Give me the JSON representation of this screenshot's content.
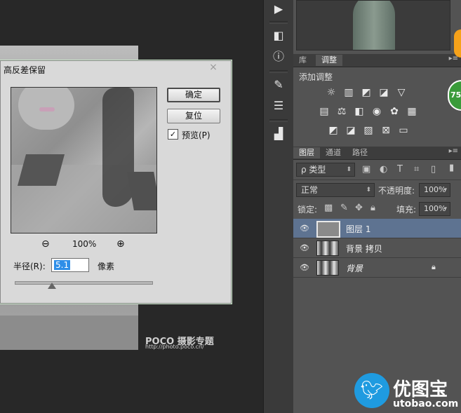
{
  "dialog": {
    "title": "高反差保留",
    "close_glyph": "×",
    "ok_label": "确定",
    "reset_label": "复位",
    "preview_label": "预览(P)",
    "preview_checked": "✓",
    "zoom_out_glyph": "⊖",
    "zoom_level": "100%",
    "zoom_in_glyph": "⊕",
    "radius_label": "半径(R):",
    "radius_value": "5.1",
    "radius_unit": "像素",
    "radius_slider_fraction": 0.27
  },
  "watermark": {
    "poco": "POCO 摄影专题",
    "poco_url": "http://photo.poco.cn/"
  },
  "tools": {
    "play_icon": "▶",
    "badge_count": "75"
  },
  "adjust_panel": {
    "tabs": [
      {
        "label": "库"
      },
      {
        "label": "调整"
      }
    ],
    "title": "添加调整"
  },
  "layers_panel": {
    "tabs": [
      {
        "label": "图层"
      },
      {
        "label": "通道"
      },
      {
        "label": "路径"
      }
    ],
    "filter_label": "ρ 类型",
    "blend_mode": "正常",
    "opacity_label": "不透明度:",
    "opacity_value": "100%",
    "lock_label": "锁定:",
    "fill_label": "填充:",
    "fill_value": "100%",
    "layers": [
      {
        "name": "图层 1",
        "selected": true
      },
      {
        "name": "背景 拷贝",
        "selected": false
      },
      {
        "name": "背景",
        "selected": false,
        "locked": true
      }
    ]
  },
  "branding": {
    "cn": "优图宝",
    "url": "utobao.com"
  },
  "colors": {
    "selected_layer": "#5e7391",
    "badge_green": "#3a9b3a",
    "badge_orange": "#f6a21a",
    "brand_blue": "#1f9be0"
  }
}
